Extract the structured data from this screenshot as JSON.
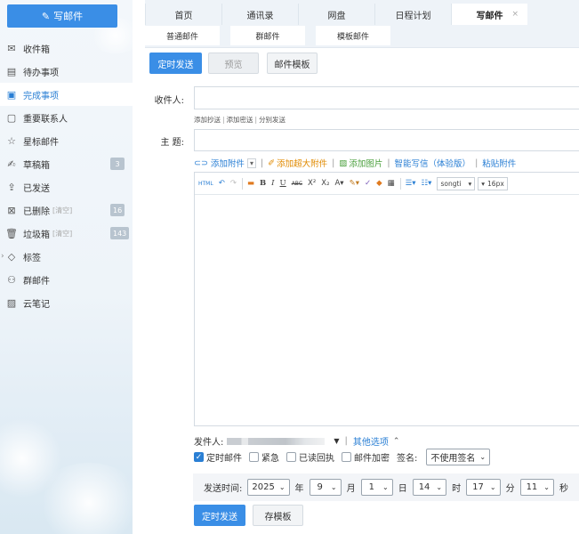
{
  "sidebar": {
    "compose_label": "写邮件",
    "items": [
      {
        "label": "收件箱",
        "icon": "inbox-icon"
      },
      {
        "label": "待办事项",
        "icon": "todo-icon"
      },
      {
        "label": "完成事项",
        "icon": "done-icon"
      },
      {
        "label": "重要联系人",
        "icon": "contact-icon"
      },
      {
        "label": "星标邮件",
        "icon": "star-icon"
      },
      {
        "label": "草稿箱",
        "icon": "draft-icon",
        "count": "3"
      },
      {
        "label": "已发送",
        "icon": "sent-icon"
      },
      {
        "label": "已删除",
        "icon": "deleted-icon",
        "clear": "[清空]",
        "count": "16"
      },
      {
        "label": "垃圾箱",
        "icon": "trash-icon",
        "clear": "[清空]",
        "count": "143"
      },
      {
        "label": "标签",
        "icon": "tag-icon"
      },
      {
        "label": "群邮件",
        "icon": "group-icon"
      },
      {
        "label": "云笔记",
        "icon": "note-icon"
      }
    ],
    "active_index": 2
  },
  "tabs": [
    {
      "label": "首页"
    },
    {
      "label": "通讯录"
    },
    {
      "label": "网盘"
    },
    {
      "label": "日程计划"
    },
    {
      "label": "写邮件",
      "close": "×"
    }
  ],
  "subtabs": [
    {
      "label": "普通邮件"
    },
    {
      "label": "群邮件"
    },
    {
      "label": "模板邮件"
    }
  ],
  "actions": {
    "send_timed": "定时发送",
    "preview": "预览",
    "template": "邮件模板"
  },
  "form": {
    "to_label": "收件人:",
    "cc_link": "添加抄送",
    "bcc_link": "添加密送",
    "separate_link": "分别发送",
    "subject_label": "主  题:",
    "attach": "添加附件",
    "attach_big": "添加超大附件",
    "attach_image": "添加图片",
    "smart_write": "智能写信（体验版）",
    "paste_attach": "粘贴附件"
  },
  "toolbar": {
    "html": "HTML",
    "font_name": "songti",
    "font_size": "16px"
  },
  "sender": {
    "label": "发件人:",
    "more_options": "其他选项"
  },
  "options": {
    "timed": "定时邮件",
    "urgent": "紧急",
    "receipt": "已读回执",
    "encrypt": "邮件加密",
    "signature_label": "签名:",
    "signature_value": "不使用签名"
  },
  "schedule": {
    "label": "发送时间:",
    "year": "2025",
    "year_unit": "年",
    "month": "9",
    "month_unit": "月",
    "day": "1",
    "day_unit": "日",
    "hour": "14",
    "hour_unit": "时",
    "minute": "17",
    "minute_unit": "分",
    "second": "11",
    "second_unit": "秒"
  },
  "bottom": {
    "send_timed": "定时发送",
    "save_template": "存模板"
  }
}
